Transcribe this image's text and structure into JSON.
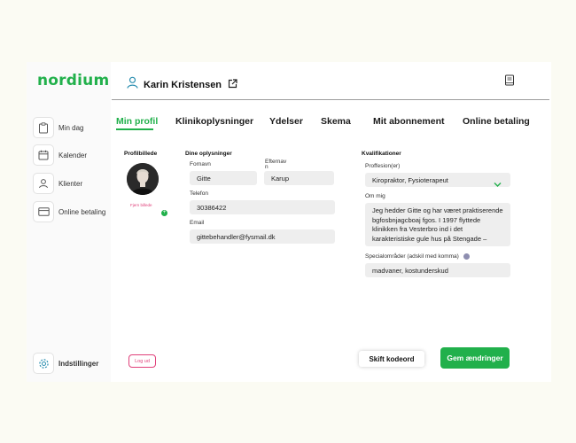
{
  "brand": {
    "logo": "nordium",
    "accent": "#21b04b",
    "danger": "#e0407a"
  },
  "sidebar": {
    "items": [
      {
        "label": "Min dag",
        "icon": "clipboard-icon"
      },
      {
        "label": "Kalender",
        "icon": "calendar-icon"
      },
      {
        "label": "Klienter",
        "icon": "user-icon"
      },
      {
        "label": "Online betaling",
        "icon": "credit-card-icon"
      }
    ],
    "settings_label": "Indstillinger"
  },
  "header": {
    "user_name": "Karin Kristensen"
  },
  "tabs": [
    "Min profil",
    "Klinikoplysninger",
    "Ydelser",
    "Skema",
    "Mit abonnement",
    "Online betaling"
  ],
  "profile": {
    "picture_title": "Profilbillede",
    "remove_label": "Fjern billede",
    "plus": "+",
    "logout_label": "Log ud"
  },
  "details": {
    "title": "Dine oplysninger",
    "first_name_label": "Fornavn",
    "first_name": "Gitte",
    "last_name_label": "Efternav\nn",
    "last_name": "Karup",
    "phone_label": "Telefon",
    "phone": "30386422",
    "email_label": "Email",
    "email": "gittebehandler@fysmail.dk"
  },
  "qualifications": {
    "title": "Kvalifikationer",
    "profession_label": "Proffesion(er)",
    "profession": "Kiropraktor, Fysioterapeut",
    "about_label": "Om mig",
    "about": "Jeg hedder Gitte og har været praktiserende bgfosbnjagcboaj fgos. I 1997 flyttede klinikken fra Vesterbro ind i det karakteristiske gule hus på Stengade –",
    "specialties_label": "Specialområder (adskil med komma)",
    "specialties": "madvaner, kostunderskud"
  },
  "actions": {
    "change_password": "Skift kodeord",
    "save": "Gem ændringer"
  }
}
